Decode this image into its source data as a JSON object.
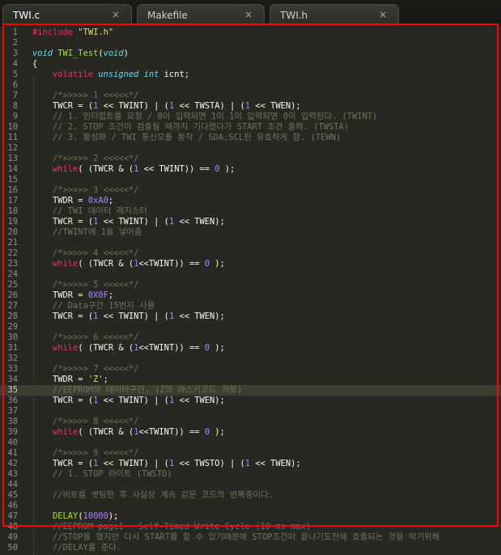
{
  "tabs": [
    {
      "label": "TWI.c",
      "close_icon": "×",
      "active": true
    },
    {
      "label": "Makefile",
      "close_icon": "×",
      "active": false
    },
    {
      "label": "TWI.h",
      "close_icon": "×",
      "active": false
    }
  ],
  "colors": {
    "background": "#272822",
    "keyword": "#f92672",
    "type": "#66d9ef",
    "number": "#ae81ff",
    "string": "#e6db74",
    "function": "#a6e22e",
    "comment": "#75715e",
    "selection_box": "#ff0000"
  },
  "current_line": 35,
  "lines": [
    {
      "n": "1",
      "tokens": [
        {
          "t": "#include ",
          "c": "kw"
        },
        {
          "t": "\"TWI.h\"",
          "c": "str"
        }
      ]
    },
    {
      "n": "2",
      "tokens": []
    },
    {
      "n": "3",
      "tokens": [
        {
          "t": "void ",
          "c": "type"
        },
        {
          "t": "TWI_Test",
          "c": "fn"
        },
        {
          "t": "(",
          "c": "ph"
        },
        {
          "t": "void",
          "c": "type"
        },
        {
          "t": ")",
          "c": "ph"
        }
      ]
    },
    {
      "n": "4",
      "tokens": [
        {
          "t": "{",
          "c": "ph"
        }
      ]
    },
    {
      "n": "5",
      "tokens": [
        {
          "t": "    ",
          "c": "ph"
        },
        {
          "t": "volatile ",
          "c": "kw"
        },
        {
          "t": "unsigned int ",
          "c": "type"
        },
        {
          "t": "icnt;",
          "c": "ph"
        }
      ]
    },
    {
      "n": "6",
      "tokens": []
    },
    {
      "n": "7",
      "tokens": [
        {
          "t": "    /*>>>>> 1 <<<<<*/",
          "c": "cmt"
        }
      ]
    },
    {
      "n": "8",
      "tokens": [
        {
          "t": "    TWCR = (",
          "c": "ph"
        },
        {
          "t": "1",
          "c": "num"
        },
        {
          "t": " << TWINT) | (",
          "c": "ph"
        },
        {
          "t": "1",
          "c": "num"
        },
        {
          "t": " << TWSTA) | (",
          "c": "ph"
        },
        {
          "t": "1",
          "c": "num"
        },
        {
          "t": " << TWEN);",
          "c": "ph"
        }
      ]
    },
    {
      "n": "9",
      "tokens": [
        {
          "t": "    // 1. 인터럽트를 요청 / 0이 입력되면 1이 1이 입력되면 0이 입력된다. (TWINT)",
          "c": "cmt"
        }
      ]
    },
    {
      "n": "10",
      "tokens": [
        {
          "t": "    // 2. STOP 조건이 검출될 때까지 기다렸다가 START 조건 출력. (TWSTA)",
          "c": "cmt"
        }
      ]
    },
    {
      "n": "11",
      "tokens": [
        {
          "t": "    // 3. 활성화 / TWI 통신모듈 동작 / SDA,SCL핀 유효하게 함. (TEWN)",
          "c": "cmt"
        }
      ]
    },
    {
      "n": "12",
      "tokens": []
    },
    {
      "n": "13",
      "tokens": [
        {
          "t": "    /*>>>>> 2 <<<<<*/",
          "c": "cmt"
        }
      ]
    },
    {
      "n": "14",
      "tokens": [
        {
          "t": "    ",
          "c": "ph"
        },
        {
          "t": "while",
          "c": "kw"
        },
        {
          "t": "( (TWCR & (",
          "c": "ph"
        },
        {
          "t": "1",
          "c": "num"
        },
        {
          "t": " << TWINT)) == ",
          "c": "ph"
        },
        {
          "t": "0",
          "c": "num"
        },
        {
          "t": " );",
          "c": "ph"
        }
      ]
    },
    {
      "n": "15",
      "tokens": []
    },
    {
      "n": "16",
      "tokens": [
        {
          "t": "    /*>>>>> 3 <<<<<*/",
          "c": "cmt"
        }
      ]
    },
    {
      "n": "17",
      "tokens": [
        {
          "t": "    TWDR = ",
          "c": "ph"
        },
        {
          "t": "0xA0",
          "c": "num"
        },
        {
          "t": ";",
          "c": "ph"
        }
      ]
    },
    {
      "n": "18",
      "tokens": [
        {
          "t": "    // TWI 데이터 레지스터",
          "c": "cmt"
        }
      ]
    },
    {
      "n": "19",
      "tokens": [
        {
          "t": "    TWCR = (",
          "c": "ph"
        },
        {
          "t": "1",
          "c": "num"
        },
        {
          "t": " << TWINT) | (",
          "c": "ph"
        },
        {
          "t": "1",
          "c": "num"
        },
        {
          "t": " << TWEN);",
          "c": "ph"
        }
      ]
    },
    {
      "n": "20",
      "tokens": [
        {
          "t": "    //TWINT에 1을 넣어줌",
          "c": "cmt"
        }
      ]
    },
    {
      "n": "21",
      "tokens": []
    },
    {
      "n": "22",
      "tokens": [
        {
          "t": "    /*>>>>> 4 <<<<<*/",
          "c": "cmt"
        }
      ]
    },
    {
      "n": "23",
      "tokens": [
        {
          "t": "    ",
          "c": "ph"
        },
        {
          "t": "while",
          "c": "kw"
        },
        {
          "t": "( (TWCR & (",
          "c": "ph"
        },
        {
          "t": "1",
          "c": "num"
        },
        {
          "t": "<<TWINT)) == ",
          "c": "ph"
        },
        {
          "t": "0",
          "c": "num"
        },
        {
          "t": " );",
          "c": "ph"
        }
      ]
    },
    {
      "n": "24",
      "tokens": []
    },
    {
      "n": "25",
      "tokens": [
        {
          "t": "    /*>>>>> 5 <<<<<*/",
          "c": "cmt"
        }
      ]
    },
    {
      "n": "26",
      "tokens": [
        {
          "t": "    TWDR = ",
          "c": "ph"
        },
        {
          "t": "0X0F",
          "c": "num"
        },
        {
          "t": ";",
          "c": "ph"
        }
      ]
    },
    {
      "n": "27",
      "tokens": [
        {
          "t": "    // Data구간 15번지 사용",
          "c": "cmt"
        }
      ]
    },
    {
      "n": "28",
      "tokens": [
        {
          "t": "    TWCR = (",
          "c": "ph"
        },
        {
          "t": "1",
          "c": "num"
        },
        {
          "t": " << TWINT) | (",
          "c": "ph"
        },
        {
          "t": "1",
          "c": "num"
        },
        {
          "t": " << TWEN);",
          "c": "ph"
        }
      ]
    },
    {
      "n": "29",
      "tokens": []
    },
    {
      "n": "30",
      "tokens": [
        {
          "t": "    /*>>>>> 6 <<<<<*/",
          "c": "cmt"
        }
      ]
    },
    {
      "n": "31",
      "tokens": [
        {
          "t": "    ",
          "c": "ph"
        },
        {
          "t": "while",
          "c": "kw"
        },
        {
          "t": "( (TWCR & (",
          "c": "ph"
        },
        {
          "t": "1",
          "c": "num"
        },
        {
          "t": "<<TWINT)) == ",
          "c": "ph"
        },
        {
          "t": "0",
          "c": "num"
        },
        {
          "t": " );",
          "c": "ph"
        }
      ]
    },
    {
      "n": "32",
      "tokens": []
    },
    {
      "n": "33",
      "tokens": [
        {
          "t": "    /*>>>>> 7 <<<<<*/",
          "c": "cmt"
        }
      ]
    },
    {
      "n": "34",
      "tokens": [
        {
          "t": "    TWDR = ",
          "c": "ph"
        },
        {
          "t": "'Z'",
          "c": "str"
        },
        {
          "t": ";",
          "c": "ph"
        }
      ]
    },
    {
      "n": "35",
      "tokens": [
        {
          "t": "    //EEPROM의 데이터구간. (Z의 아스키코드 저장)",
          "c": "cmt"
        }
      ]
    },
    {
      "n": "36",
      "tokens": [
        {
          "t": "    TWCR = (",
          "c": "ph"
        },
        {
          "t": "1",
          "c": "num"
        },
        {
          "t": " << TWINT) | (",
          "c": "ph"
        },
        {
          "t": "1",
          "c": "num"
        },
        {
          "t": " << TWEN);",
          "c": "ph"
        }
      ]
    },
    {
      "n": "37",
      "tokens": []
    },
    {
      "n": "38",
      "tokens": [
        {
          "t": "    /*>>>>> 8 <<<<<*/",
          "c": "cmt"
        }
      ]
    },
    {
      "n": "39",
      "tokens": [
        {
          "t": "    ",
          "c": "ph"
        },
        {
          "t": "while",
          "c": "kw"
        },
        {
          "t": "( (TWCR & (",
          "c": "ph"
        },
        {
          "t": "1",
          "c": "num"
        },
        {
          "t": "<<TWINT)) == ",
          "c": "ph"
        },
        {
          "t": "0",
          "c": "num"
        },
        {
          "t": " );",
          "c": "ph"
        }
      ]
    },
    {
      "n": "40",
      "tokens": []
    },
    {
      "n": "41",
      "tokens": [
        {
          "t": "    /*>>>>> 9 <<<<<*/",
          "c": "cmt"
        }
      ]
    },
    {
      "n": "42",
      "tokens": [
        {
          "t": "    TWCR = (",
          "c": "ph"
        },
        {
          "t": "1",
          "c": "num"
        },
        {
          "t": " << TWINT) | (",
          "c": "ph"
        },
        {
          "t": "1",
          "c": "num"
        },
        {
          "t": " << TWSTO) | (",
          "c": "ph"
        },
        {
          "t": "1",
          "c": "num"
        },
        {
          "t": " << TWEN);",
          "c": "ph"
        }
      ]
    },
    {
      "n": "43",
      "tokens": [
        {
          "t": "    // 1. STOP 라이트 (TWSTO)",
          "c": "cmt"
        }
      ]
    },
    {
      "n": "44",
      "tokens": []
    },
    {
      "n": "45",
      "tokens": [
        {
          "t": "    //비트를 셋팅한 후 사실상 계속 같은 코드의 반복중이다.",
          "c": "cmt"
        }
      ]
    },
    {
      "n": "46",
      "tokens": []
    },
    {
      "n": "47",
      "tokens": [
        {
          "t": "    ",
          "c": "ph"
        },
        {
          "t": "DELAY",
          "c": "fn"
        },
        {
          "t": "(",
          "c": "ph"
        },
        {
          "t": "10000",
          "c": "num"
        },
        {
          "t": ");",
          "c": "ph"
        }
      ]
    },
    {
      "n": "48",
      "tokens": [
        {
          "t": "    //EEPROM page1 - Self-Timed Write Cycle (10 ms max)",
          "c": "cmt"
        }
      ]
    },
    {
      "n": "49",
      "tokens": [
        {
          "t": "    //STOP을 했지만 다시 START를 할 수 있기때문에 STOP조건이 끝나기도전에 호출되는 것을 막기위해",
          "c": "cmt"
        }
      ]
    },
    {
      "n": "50",
      "tokens": [
        {
          "t": "    //DELAY를 준다.",
          "c": "cmt"
        }
      ]
    }
  ]
}
